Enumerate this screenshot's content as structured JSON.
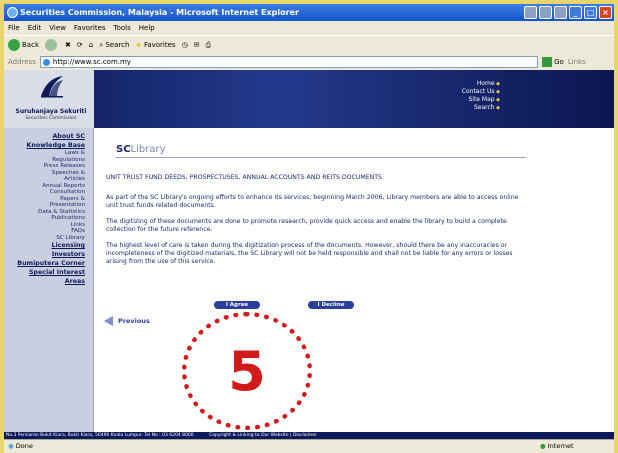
{
  "window": {
    "title": "Securities Commission, Malaysia - Microsoft Internet Explorer"
  },
  "menu": [
    "File",
    "Edit",
    "View",
    "Favorites",
    "Tools",
    "Help"
  ],
  "toolbar": {
    "back": "Back",
    "search": "Search",
    "favorites": "Favorites"
  },
  "address": {
    "label": "Address",
    "url": "http://www.sc.com.my",
    "go": "Go",
    "links": "Links"
  },
  "header": {
    "logo_name": "Suruhanjaya Sekuriti",
    "logo_sub": "Securities Commission",
    "top_links": [
      "Home",
      "Contact Us",
      "Site Map",
      "Search"
    ]
  },
  "sidebar": [
    {
      "label": "About SC",
      "bold": true
    },
    {
      "label": "Knowledge Base",
      "bold": true
    },
    {
      "label": "Laws &",
      "bold": false
    },
    {
      "label": "Regulations",
      "bold": false
    },
    {
      "label": "Press Releases",
      "bold": false
    },
    {
      "label": "Speeches &",
      "bold": false
    },
    {
      "label": "Articles",
      "bold": false
    },
    {
      "label": "Annual Reports",
      "bold": false
    },
    {
      "label": "Consultation",
      "bold": false
    },
    {
      "label": "Papers &",
      "bold": false
    },
    {
      "label": "Presentation",
      "bold": false
    },
    {
      "label": "Data & Statistics",
      "bold": false
    },
    {
      "label": "Publications",
      "bold": false
    },
    {
      "label": "Links",
      "bold": false
    },
    {
      "label": "FAQs",
      "bold": false
    },
    {
      "label": "SC Library",
      "bold": false
    },
    {
      "label": "Licensing",
      "bold": true
    },
    {
      "label": "Investors",
      "bold": true
    },
    {
      "label": "Bumiputera Corner",
      "bold": true
    },
    {
      "label": "Special Interest",
      "bold": true
    },
    {
      "label": "Areas",
      "bold": true
    }
  ],
  "main": {
    "title_a": "SC",
    "title_b": "Library",
    "heading": "UNIT TRUST FUND DEEDS, PROSPECTUSES, ANNUAL ACCOUNTS AND REITS DOCUMENTS",
    "paragraphs": [
      "As part of the SC Library's ongoing efforts to enhance its services, beginning March 2006, Library members are able to access online unit trust funds related documents.",
      "The digitizing of these documents are done to promote research, provide quick access and enable the library to build a complete collection for the future reference.",
      "The highest level of care is taken during the digitization process of the documents. However, should there be any inaccuracies or incompleteness of the digitized materials, the SC Library will not be held responsible and shall not be liable for any errors or losses arising from the use of this service."
    ],
    "agree": "I Agree",
    "decline": "I Decline",
    "previous": "Previous"
  },
  "footer": {
    "address": "No.3 Persiaran Bukit Kiara, Bukit Kiara, 50490 Kuala Lumpur. Tel No : 03 6204 8000",
    "links": "Copyright & Linking to Our Website | Disclaimer"
  },
  "status": {
    "left": "Done",
    "zone": "Internet"
  },
  "annotation": {
    "number": "5",
    "color": "#d11a1a"
  }
}
